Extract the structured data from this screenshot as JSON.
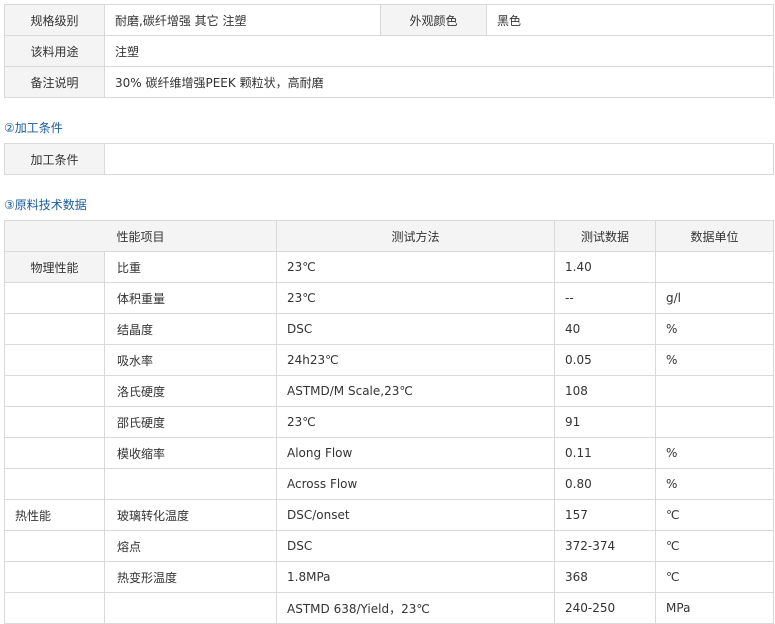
{
  "spec": {
    "grade_label": "规格级别",
    "grade_value": "耐磨,碳纤增强 其它 注塑",
    "color_label": "外观颜色",
    "color_value": "黑色",
    "use_label": "该料用途",
    "use_value": "注塑",
    "note_label": "备注说明",
    "note_value": "30% 碳纤维增强PEEK 颗粒状，高耐磨"
  },
  "processing": {
    "heading": "②加工条件",
    "label": "加工条件",
    "value": ""
  },
  "tech": {
    "heading": "③原料技术数据",
    "headers": [
      "性能项目",
      "测试方法",
      "测试数据",
      "数据单位"
    ],
    "rows": [
      {
        "cat": "物理性能",
        "item": "比重",
        "method": "23℃",
        "value": "1.40",
        "unit": ""
      },
      {
        "cat": "",
        "item": "体积重量",
        "method": "23℃",
        "value": "--",
        "unit": "g/l"
      },
      {
        "cat": "",
        "item": "结晶度",
        "method": "DSC",
        "value": " 40",
        "unit": "%"
      },
      {
        "cat": "",
        "item": "吸水率",
        "method": "24h23℃",
        "value": " 0.05",
        "unit": "%"
      },
      {
        "cat": "",
        "item": "洛氏硬度",
        "method": "ASTMD/M Scale,23℃",
        "value": "108",
        "unit": ""
      },
      {
        "cat": "",
        "item": "邵氏硬度",
        "method": "23℃",
        "value": " 91",
        "unit": ""
      },
      {
        "cat": "",
        "item": "模收缩率",
        "method": "Along Flow",
        "value": " 0.11",
        "unit": "%"
      },
      {
        "cat": "",
        "item": "",
        "method": "Across Flow",
        "value": "0.80",
        "unit": "%"
      },
      {
        "cat": "热性能",
        "item": "玻璃转化温度",
        "method": "DSC/onset",
        "value": " 157",
        "unit": "℃"
      },
      {
        "cat": "",
        "item": "熔点",
        "method": "DSC",
        "value": "372-374",
        "unit": "℃"
      },
      {
        "cat": "",
        "item": "热变形温度",
        "method": "1.8MPa",
        "value": "368",
        "unit": "℃"
      },
      {
        "cat": "",
        "item": "",
        "method": "ASTMD 638/Yield，23℃",
        "value": "240-250",
        "unit": "MPa"
      }
    ]
  }
}
